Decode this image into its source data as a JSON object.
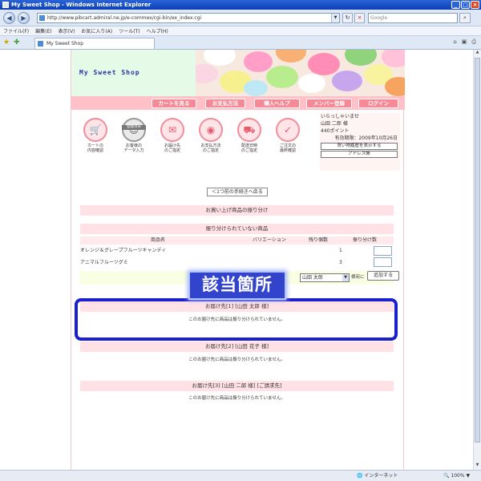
{
  "window": {
    "title": "My Sweet Shop - Windows Internet Explorer"
  },
  "browser": {
    "url": "http://www.pibcart.admiral.ne.jp/e-commex/cgi-bin/ex_index.cgi",
    "search_placeholder": "Google",
    "menu": [
      "ファイル(F)",
      "編集(E)",
      "表示(V)",
      "お気に入り(A)",
      "ツール(T)",
      "ヘルプ(H)"
    ],
    "tab_label": "My Sweet Shop"
  },
  "shop": {
    "logo": "My Sweet Shop",
    "nav": [
      "カートを見る",
      "お支払方法",
      "購入ヘルプ",
      "メンバー登録",
      "ログイン"
    ],
    "steps": [
      {
        "label": "カートの\n内容確認",
        "done": false
      },
      {
        "label": "お客様の\nデータ入力",
        "done": true,
        "badge": "登録済み"
      },
      {
        "label": "お届け先\nのご指定",
        "done": false
      },
      {
        "label": "お支払方法\nのご指定",
        "done": false
      },
      {
        "label": "配送日時\nのご指定",
        "done": false
      },
      {
        "label": "ご注文の\n最終確認",
        "done": false
      }
    ],
    "user": {
      "greeting": "いらっしゃいませ",
      "name": "山田 二郎 様",
      "points": "440ポイント",
      "expiry": "有効期限：2009年10月26日",
      "history_button": "買い物履歴を表示する",
      "address_button": "アドレス帳"
    },
    "back_button": "＜1つ前の手続きへ戻る",
    "section_title": "お買い上げ商品の振り分け",
    "unassigned_title": "振り分けられていない商品",
    "columns": [
      "商品名",
      "バリエーション",
      "残り個数",
      "振り分け数"
    ],
    "items": [
      {
        "name": "オレンジ＆グレープフルーツキャンディ",
        "variation": "",
        "remaining": "1"
      },
      {
        "name": "アニマルフルーツグミ",
        "variation": "",
        "remaining": "3"
      }
    ],
    "assign_select": "山田 太郎",
    "assign_suffix": "様宛に",
    "add_button": "追加する",
    "callout": "該当箇所",
    "destinations": [
      {
        "title": "お届け先[1] [山田 太郎  様]",
        "note": "このお届け先に商品は振り分けられていません。"
      },
      {
        "title": "お届け先[2] [山田 花子  様]",
        "note": "このお届け先に商品は振り分けられていません。"
      },
      {
        "title": "お届け先[3] [山田 二郎  様] [ご請求先]",
        "note": "このお届け先に商品は振り分けられていません。"
      }
    ]
  },
  "status": {
    "zone": "インターネット",
    "zoom": "100%"
  }
}
